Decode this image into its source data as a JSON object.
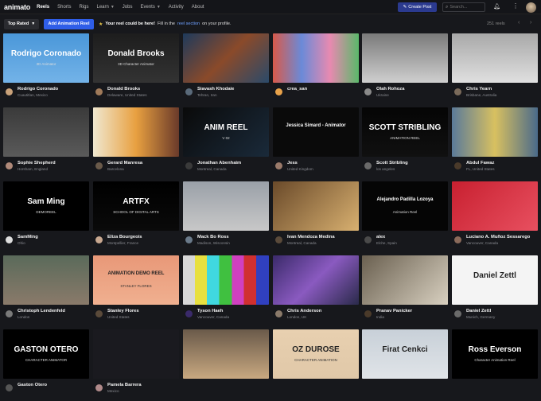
{
  "nav": {
    "logo": "animato",
    "links": [
      {
        "label": "Reels",
        "active": true,
        "caret": false
      },
      {
        "label": "Shorts",
        "active": false,
        "caret": false
      },
      {
        "label": "Rigs",
        "active": false,
        "caret": false
      },
      {
        "label": "Learn",
        "active": false,
        "caret": true
      },
      {
        "label": "Jobs",
        "active": false,
        "caret": false
      },
      {
        "label": "Events",
        "active": false,
        "caret": true
      },
      {
        "label": "Activity",
        "active": false,
        "caret": false
      },
      {
        "label": "About",
        "active": false,
        "caret": false
      }
    ],
    "create_label": "Create Post",
    "search_placeholder": "Search..."
  },
  "toolbar": {
    "sort_label": "Top Rated",
    "add_label": "Add Animation Reel",
    "promo_bold": "Your reel could be here!",
    "promo_text": "Fill in the",
    "promo_link": "reel section",
    "promo_tail": "on your profile.",
    "count": "251 reels"
  },
  "reels": [
    {
      "name": "Rodrigo Coronado",
      "location": "Cuautitlan, Mexico",
      "thumb_text": "Rodrigo Coronado",
      "thumb_sub": "3D Animator",
      "bg": "linear-gradient(#4a97d9,#73b3e8)",
      "av": "#c9a27a"
    },
    {
      "name": "Donald Brooks",
      "location": "Delaware, United States",
      "thumb_text": "Donald Brooks",
      "thumb_sub": "3D Character Animator",
      "bg": "linear-gradient(#1d1d1d,#333)",
      "av": "#a07a5a"
    },
    {
      "name": "Siavash Khodaie",
      "location": "Tehran, Iran",
      "thumb_text": "",
      "thumb_sub": "",
      "bg": "linear-gradient(135deg,#1e3a5c,#8a4a2a,#2a4a6a)",
      "av": "#5a6a7a"
    },
    {
      "name": "crea_san",
      "location": "",
      "thumb_text": "",
      "thumb_sub": "",
      "bg": "linear-gradient(90deg,#d85a4a,#6a8ad8,#e88ab0,#5ab86a)",
      "av": "#e8a24a"
    },
    {
      "name": "Olah Rohoza",
      "location": "Ukraine",
      "thumb_text": "",
      "thumb_sub": "",
      "bg": "linear-gradient(#7a7a7a,#cfcfcf)",
      "av": "#8a8a8a"
    },
    {
      "name": "Chris Yearn",
      "location": "Brisbane, Australia",
      "thumb_text": "",
      "thumb_sub": "",
      "bg": "linear-gradient(#a8a8a8,#e0e0e0)",
      "av": "#7a6a5a"
    },
    {
      "name": "Sophie Shepherd",
      "location": "Horsham, England",
      "thumb_text": "",
      "thumb_sub": "",
      "bg": "linear-gradient(#3a3a3a,#5a5a5a)",
      "av": "#b08a7a"
    },
    {
      "name": "Gerard Manresa",
      "location": "Barcelona",
      "thumb_text": "",
      "thumb_sub": "",
      "bg": "linear-gradient(90deg,#f0e8d0,#e8a040,#6a3a2a)",
      "av": "#6a5a4a"
    },
    {
      "name": "Jonathan Abenhaim",
      "location": "Montreal, Canada",
      "thumb_text": "ANIM REEL",
      "thumb_sub": "V 02",
      "bg": "linear-gradient(135deg,#0a0a0a,#1a2a3a)",
      "av": "#3a3a3a"
    },
    {
      "name": "Jess",
      "location": "United Kingdom",
      "thumb_text": "Jessica Simard - Animator",
      "thumb_sub": "",
      "bg": "linear-gradient(#0a0a0a,#0a0a0a)",
      "av": "#9a7a6a"
    },
    {
      "name": "Scott Stribling",
      "location": "los angeles",
      "thumb_text": "SCOTT STRIBLING",
      "thumb_sub": "ANIMATION REEL",
      "bg": "linear-gradient(#050505,#101010)",
      "av": "#6a6a6a"
    },
    {
      "name": "Abdul Fawaz",
      "location": "FL, United States",
      "thumb_text": "",
      "thumb_sub": "",
      "bg": "linear-gradient(90deg,#5a7a9a,#d8c060,#4a6a8a)",
      "av": "#4a3a2a"
    },
    {
      "name": "SamMing",
      "location": "Ohio",
      "thumb_text": "Sam Ming",
      "thumb_sub": "DEMOREEL",
      "bg": "linear-gradient(#000,#000)",
      "av": "#dddddd"
    },
    {
      "name": "Eliza Bourgeois",
      "location": "Montpellier, France",
      "thumb_text": "ARTFX",
      "thumb_sub": "SCHOOL OF DIGITAL ARTS",
      "bg": "linear-gradient(#000,#0a0a0a)",
      "av": "#c8a890"
    },
    {
      "name": "Mack Bo Ross",
      "location": "Madison, Wisconsin",
      "thumb_text": "",
      "thumb_sub": "",
      "bg": "linear-gradient(#9aa0a8,#c8c8c8)",
      "av": "#6a7a8a"
    },
    {
      "name": "Ivan Mendoza Medina",
      "location": "Montreal, Canada",
      "thumb_text": "",
      "thumb_sub": "",
      "bg": "linear-gradient(135deg,#6a4a2a,#d8b070)",
      "av": "#5a4a3a"
    },
    {
      "name": "alex",
      "location": "Elche, Spain",
      "thumb_text": "Alejandro Padilla Lozoya",
      "thumb_sub": "Animation Reel",
      "bg": "linear-gradient(#050505,#050505)",
      "av": "#4a4a4a"
    },
    {
      "name": "Luciano A. Muñoz Sessarego",
      "location": "Vancouver, Canada",
      "thumb_text": "",
      "thumb_sub": "",
      "bg": "linear-gradient(135deg,#c82030,#e85060)",
      "av": "#8a6a5a"
    },
    {
      "name": "Christoph Lendenfeld",
      "location": "London",
      "thumb_text": "",
      "thumb_sub": "",
      "bg": "linear-gradient(#5a6a5a,#8a7a6a)",
      "av": "#7a7a7a"
    },
    {
      "name": "Stanley Flores",
      "location": "United States",
      "thumb_text": "ANIMATION DEMO REEL",
      "thumb_sub": "STANLEY FLORES",
      "bg": "linear-gradient(#e89878,#f0b090)",
      "av": "#5a4a3a"
    },
    {
      "name": "Tyson Haeh",
      "location": "Vancouver, Canada",
      "thumb_text": "",
      "thumb_sub": "",
      "bg": "linear-gradient(90deg,#d8d8d8 0 14%,#e8e040 14% 28%,#40d8e0 28% 42%,#40c040 42% 57%,#d040c0 57% 71%,#d03030 71% 85%,#3040c0 85%)",
      "av": "#3a2a6a"
    },
    {
      "name": "Chris Anderson",
      "location": "London, UK",
      "thumb_text": "",
      "thumb_sub": "",
      "bg": "linear-gradient(135deg,#3a2a6a,#8a5ac0,#2a2a4a)",
      "av": "#8a7a6a"
    },
    {
      "name": "Pranav Panicker",
      "location": "India",
      "thumb_text": "",
      "thumb_sub": "",
      "bg": "linear-gradient(135deg,#6a6050,#d8d0c0)",
      "av": "#4a3a2a"
    },
    {
      "name": "Daniel Zettl",
      "location": "Munich, Germany",
      "thumb_text": "Daniel Zettl",
      "thumb_sub": "",
      "bg": "linear-gradient(#f4f4f4,#f4f4f4)",
      "av": "#6a6a6a"
    },
    {
      "name": "Gaston Otero",
      "location": "",
      "thumb_text": "GASTON OTERO",
      "thumb_sub": "CHARACTER ANIMATOR",
      "bg": "linear-gradient(#000,#000)",
      "av": "#555"
    },
    {
      "name": "Pamela Barrera",
      "location": "Mexico",
      "thumb_text": "",
      "thumb_sub": "",
      "bg": "linear-gradient(#1a1a1f,#1a1a1f)",
      "av": "#b08a8a"
    },
    {
      "name": "",
      "location": "",
      "thumb_text": "",
      "thumb_sub": "",
      "bg": "linear-gradient(#6a5a4a,#c8a880)",
      "av": "#555"
    },
    {
      "name": "",
      "location": "",
      "thumb_text": "OZ DUROSE",
      "thumb_sub": "CHARACTER ANIMATION",
      "bg": "linear-gradient(#e8d0b0,#e0c8a8)",
      "av": "#555"
    },
    {
      "name": "",
      "location": "",
      "thumb_text": "Firat Cenkci",
      "thumb_sub": "",
      "bg": "linear-gradient(#c8d0d8,#e0e4e8)",
      "av": "#555"
    },
    {
      "name": "",
      "location": "",
      "thumb_text": "Ross Everson",
      "thumb_sub": "Character Animation Reel",
      "bg": "linear-gradient(#000,#000)",
      "av": "#555"
    }
  ]
}
